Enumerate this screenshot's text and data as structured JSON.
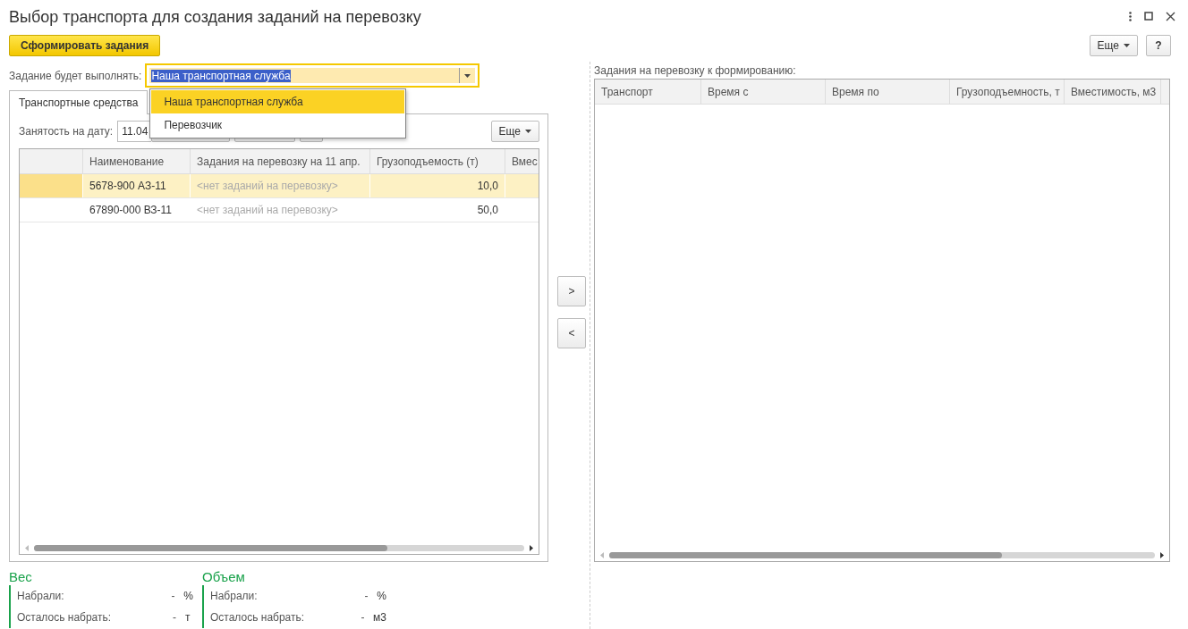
{
  "window": {
    "title": "Выбор транспорта для создания заданий на перевозку"
  },
  "toolbar": {
    "primary_button": "Сформировать задания",
    "more_button": "Еще",
    "help_button": "?"
  },
  "executor": {
    "label": "Задание будет выполнять:",
    "value": "Наша транспортная служба",
    "expanded": true,
    "options": [
      {
        "label": "Наша транспортная служба",
        "selected": true
      },
      {
        "label": "Перевозчик",
        "selected": false
      }
    ]
  },
  "tabs": [
    {
      "label": "Транспортные средства",
      "selected": true
    }
  ],
  "vehicles": {
    "date_label": "Занятость на дату:",
    "date_value": "11.04",
    "more_button": "Еще",
    "columns": [
      "Наименование",
      "Задания на перевозку на 11 апр.",
      "Грузоподъемость (т)",
      "Вмес"
    ],
    "rows": [
      {
        "selected": true,
        "cells": [
          "5678-900 АЗ-11",
          "<нет заданий на перевозку>",
          "10,0"
        ]
      },
      {
        "selected": false,
        "cells": [
          "67890-000 ВЗ-11",
          "<нет заданий на перевозку>",
          "50,0"
        ]
      }
    ]
  },
  "move_buttons": [
    ">",
    "<"
  ],
  "tasks": {
    "label": "Задания на перевозку к формированию:",
    "columns": [
      "Транспорт",
      "Время с",
      "Время по",
      "Грузоподъемность, т",
      "Вместимость, м3"
    ]
  },
  "totals": [
    {
      "title": "Вес",
      "rows": [
        {
          "label": "Набрали:",
          "value": "-",
          "unit": "%"
        },
        {
          "label": "Осталось набрать:",
          "value": "-",
          "unit": "т"
        }
      ]
    },
    {
      "title": "Объем",
      "rows": [
        {
          "label": "Набрали:",
          "value": "-",
          "unit": "%"
        },
        {
          "label": "Осталось набрать:",
          "value": "-",
          "unit": "м3"
        }
      ]
    }
  ]
}
